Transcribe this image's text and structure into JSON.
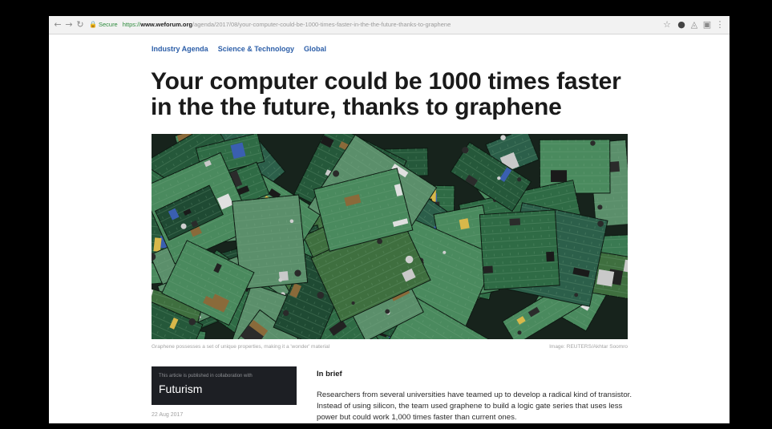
{
  "browser": {
    "secure_label": "Secure",
    "url_scheme": "https://",
    "url_host": "www.weforum.org",
    "url_path": "/agenda/2017/08/your-computer-could-be-1000-times-faster-in-the-the-future-thanks-to-graphene"
  },
  "article": {
    "tags": [
      "Industry Agenda",
      "Science & Technology",
      "Global"
    ],
    "headline": "Your computer could be 1000 times faster in the the future, thanks to graphene",
    "image_caption": "Graphene possesses a set of unique properties, making it a 'wonder' material",
    "image_credit": "Image: REUTERS/Akhtar Soomro",
    "partner_note": "This article is published in collaboration with",
    "partner_name": "Futurism",
    "date": "22 Aug 2017",
    "brief_title": "In brief",
    "brief_text": "Researchers from several universities have teamed up to develop a radical kind of transistor. Instead of using silicon, the team used graphene to build a logic gate series that uses less power but could work 1,000 times faster than current ones."
  }
}
